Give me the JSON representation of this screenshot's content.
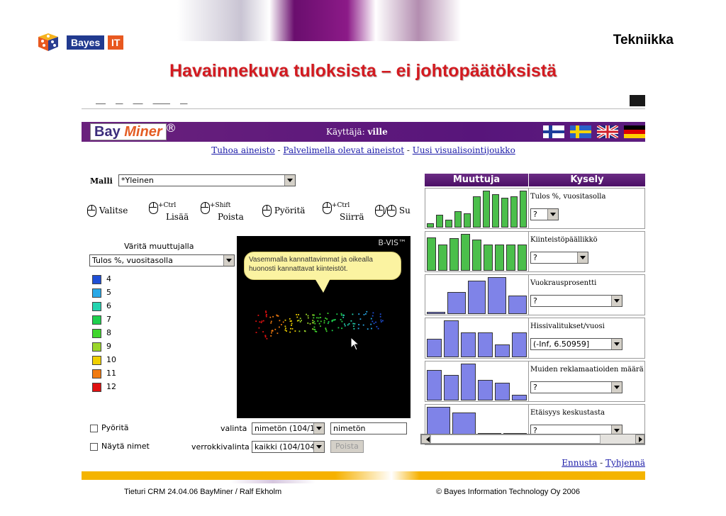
{
  "slide": {
    "logo_text": "Bayes",
    "logo_it": "IT",
    "section": "Tekniikka",
    "title": "Havainnekuva tuloksista – ei johtopäätöksistä",
    "footer_left": "Tieturi CRM 24.04.06 BayMiner / Ralf Ekholm",
    "footer_right": "© Bayes Information Technology Oy 2006"
  },
  "app": {
    "logo_bay": "Bay",
    "logo_miner": "Miner",
    "logo_reg": "®",
    "user_label": "Käyttäjä:",
    "user_name": "ville",
    "links": {
      "destroy": "Tuhoa aineisto",
      "server": "Palvelimella olevat aineistot",
      "new_set": "Uusi visualisointijoukko",
      "sep": " - "
    },
    "flags": [
      "finland-flag",
      "sweden-flag",
      "uk-flag",
      "germany-flag"
    ]
  },
  "controls": {
    "model_label": "Malli",
    "model_value": "*Yleinen",
    "tools": {
      "select": "Valitse",
      "add_mod": "+Ctrl",
      "add": "Lisää",
      "remove_mod": "+Shift",
      "remove": "Poista",
      "rotate": "Pyöritä",
      "move_mod": "+Ctrl",
      "move": "Siirrä",
      "zoom": "Su"
    },
    "color_by_label": "Väritä muuttujalla",
    "color_by_value": "Tulos %, vuositasolla",
    "legend": [
      {
        "label": "4",
        "color": "#1f4fd6"
      },
      {
        "label": "5",
        "color": "#29a9e8"
      },
      {
        "label": "6",
        "color": "#24d4b0"
      },
      {
        "label": "7",
        "color": "#1ed04d"
      },
      {
        "label": "8",
        "color": "#3fd62c"
      },
      {
        "label": "9",
        "color": "#9ad62a"
      },
      {
        "label": "10",
        "color": "#f0d000"
      },
      {
        "label": "11",
        "color": "#f07a10"
      },
      {
        "label": "12",
        "color": "#e01010"
      }
    ],
    "rotate_check": "Pyöritä",
    "show_names_check": "Näytä nimet",
    "selection_label": "valinta",
    "selection_value": "nimetön (104/1",
    "selection_name": "nimetön",
    "ref_label": "verrokkivalinta",
    "ref_value": "kaikki (104/104",
    "remove_button": "Poista"
  },
  "bvis": {
    "label": "B-VIS™",
    "bubble_text": "Vasemmalla kannattavimmat ja oikealla huonosti kannattavat kiinteistöt."
  },
  "grid": {
    "col_variable": "Muuttuja",
    "col_query": "Kysely",
    "rows": [
      {
        "label": "Tulos %, vuositasolla",
        "value": "?",
        "bars": [
          0.12,
          0.35,
          0.22,
          0.45,
          0.38,
          0.85,
          1.0,
          0.9,
          0.8,
          0.85,
          1.0
        ],
        "color": "#4bbf4b"
      },
      {
        "label": "Kiinteistöpäällikkö",
        "value": "?",
        "bars": [
          0.9,
          0.72,
          0.88,
          1.0,
          0.85,
          0.72,
          0.72,
          0.72,
          0.72
        ],
        "color": "#4bbf4b"
      },
      {
        "label": "Vuokrausprosentti",
        "value": "?",
        "bars": [
          0.06,
          0.6,
          0.9,
          1.0,
          0.5
        ],
        "color": "#7f83e8"
      },
      {
        "label": "Hissivalitukset/vuosi",
        "value": "(-Inf, 6.50959]",
        "bars": [
          0.5,
          1.0,
          0.68,
          0.68,
          0.35,
          0.68
        ],
        "color": "#7f83e8"
      },
      {
        "label": "Muiden reklamaatioiden määrä",
        "value": "?",
        "bars": [
          0.82,
          0.7,
          1.0,
          0.55,
          0.48,
          0.15
        ],
        "color": "#7f83e8"
      },
      {
        "label": "Etäisyys keskustasta",
        "value": "?",
        "bars": [
          1.0,
          0.85,
          0.28,
          0.28
        ],
        "color": "#7f83e8"
      }
    ]
  },
  "bottom": {
    "forecast": "Ennusta",
    "sep": " - ",
    "clear": "Tyhjennä"
  }
}
